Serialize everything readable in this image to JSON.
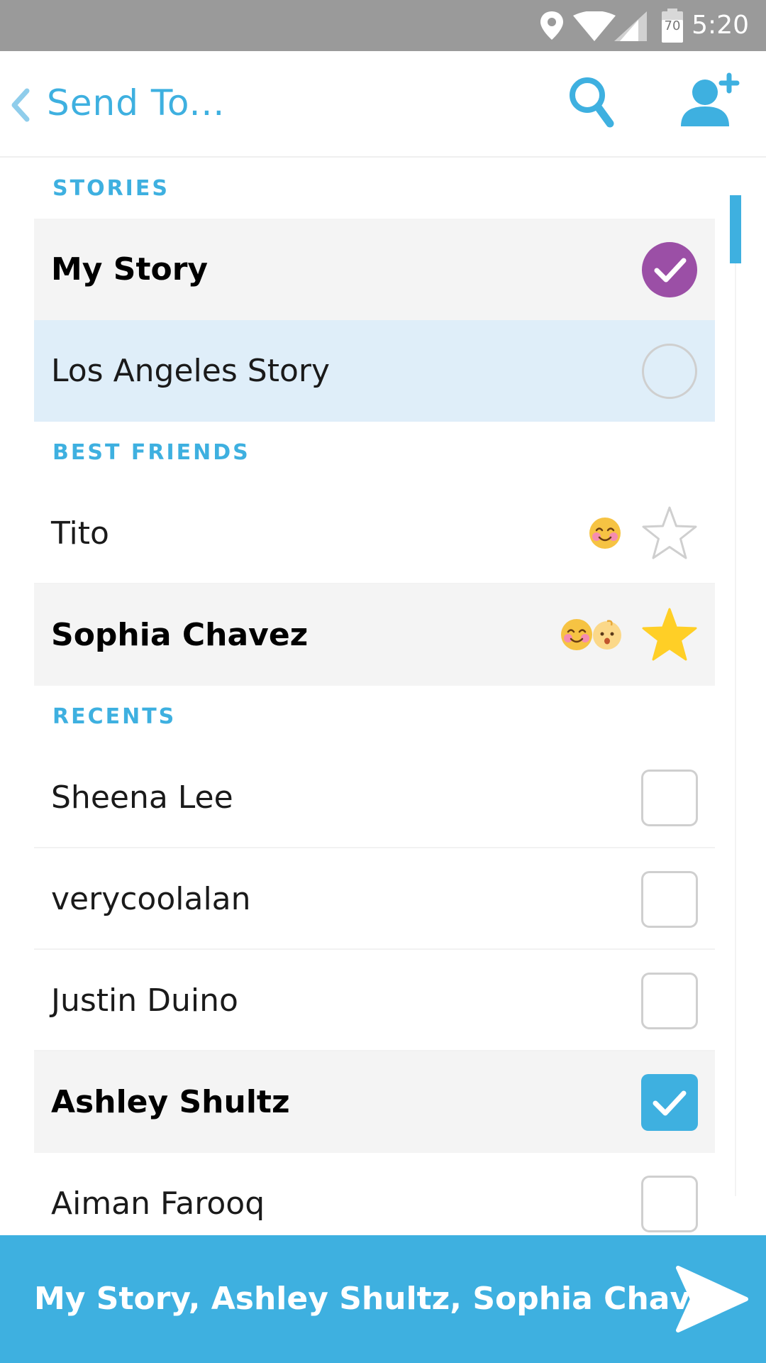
{
  "status_bar": {
    "time": "5:20",
    "battery_level": "70",
    "icons": [
      "location-pin-icon",
      "wifi-icon",
      "cell-signal-icon",
      "battery-icon"
    ]
  },
  "header": {
    "title": "Send To...",
    "back_icon": "chevron-left-icon",
    "search_icon": "search-icon",
    "add_friend_icon": "add-friend-icon"
  },
  "colors": {
    "accent": "#3eb0e0",
    "story_check": "#9b4fa6",
    "star": "#ffcf26",
    "selected_row": "#f4f4f4",
    "highlight_row": "#dfeef9"
  },
  "sections": {
    "stories": {
      "label": "STORIES",
      "items": [
        {
          "name": "My Story",
          "selected": true
        },
        {
          "name": "Los Angeles Story",
          "selected": false
        }
      ]
    },
    "best_friends": {
      "label": "BEST FRIENDS",
      "items": [
        {
          "name": "Tito",
          "selected": false,
          "emojis": [
            "smiling-blush-emoji"
          ]
        },
        {
          "name": "Sophia Chavez",
          "selected": true,
          "emojis": [
            "smiling-blush-emoji",
            "baby-emoji"
          ]
        }
      ]
    },
    "recents": {
      "label": "RECENTS",
      "items": [
        {
          "name": "Sheena Lee",
          "selected": false
        },
        {
          "name": "verycoolalan",
          "selected": false
        },
        {
          "name": "Justin Duino",
          "selected": false
        },
        {
          "name": "Ashley Shultz",
          "selected": true
        },
        {
          "name": "Aiman Farooq",
          "selected": false
        }
      ]
    }
  },
  "send_bar": {
    "recipients": "My Story, Ashley Shultz, Sophia Chavez",
    "send_icon": "send-arrow-icon"
  }
}
